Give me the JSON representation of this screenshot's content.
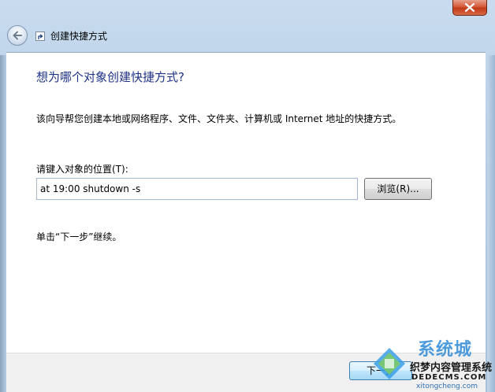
{
  "window": {
    "close_label": "✕"
  },
  "header": {
    "title": "创建快捷方式"
  },
  "main": {
    "question": "想为哪个对象创建快捷方式?",
    "description": "该向导帮您创建本地或网络程序、文件、文件夹、计算机或 Internet 地址的快捷方式。",
    "location_label": "请键入对象的位置(T):",
    "location_value": "at 19:00 shutdown -s",
    "browse_label": "浏览(R)...",
    "hint": "单击“下一步”继续。"
  },
  "footer": {
    "next_label": "下一步"
  },
  "watermark": {
    "brand": "系统城",
    "line1": "织梦内容管理系统",
    "line2": "DEDECMS.COM",
    "line3": "xitongcheng.com"
  },
  "colors": {
    "question_blue": "#1e3287",
    "close_red": "#c23a18",
    "frame_blue": "#b3cbe4"
  }
}
